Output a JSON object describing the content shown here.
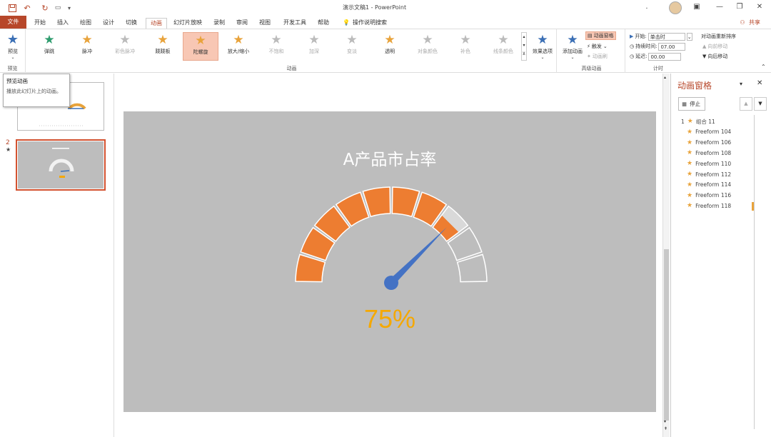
{
  "titlebar": {
    "title": "演示文稿1 - PowerPoint",
    "undo_count": "5"
  },
  "tabs": [
    "文件",
    "开始",
    "插入",
    "绘图",
    "设计",
    "切换",
    "动画",
    "幻灯片放映",
    "录制",
    "审阅",
    "视图",
    "开发工具",
    "帮助"
  ],
  "tell_me": "操作说明搜索",
  "share": "共享",
  "ribbon": {
    "preview": {
      "label": "预览",
      "group": "预览"
    },
    "effects": [
      {
        "label": "弹跳",
        "color": "#2e9c6e"
      },
      {
        "label": "脉冲",
        "color": "#e8a33b"
      },
      {
        "label": "彩色脉冲",
        "color": "#bbbbbb"
      },
      {
        "label": "跷跷板",
        "color": "#e8a33b"
      },
      {
        "label": "陀螺旋",
        "color": "#e8a33b"
      },
      {
        "label": "放大/缩小",
        "color": "#e8a33b"
      },
      {
        "label": "不饱和",
        "color": "#bbbbbb"
      },
      {
        "label": "加深",
        "color": "#bbbbbb"
      },
      {
        "label": "变淡",
        "color": "#bbbbbb"
      },
      {
        "label": "透明",
        "color": "#e8a33b"
      },
      {
        "label": "对象颜色",
        "color": "#bbbbbb"
      },
      {
        "label": "补色",
        "color": "#bbbbbb"
      },
      {
        "label": "线条颜色",
        "color": "#bbbbbb"
      }
    ],
    "effect_options": "效果选项",
    "anim_group": "动画",
    "add_anim": "添加动画",
    "anim_pane_btn": "动画窗格",
    "trigger": "触发",
    "anim_painter": "动画刷",
    "adv_group": "高级动画",
    "start_label": "开始:",
    "start_value": "单击时",
    "duration_label": "持续时间:",
    "duration_value": "07.00",
    "delay_label": "延迟:",
    "delay_value": "00.00",
    "reorder": "对动画重新排序",
    "move_earlier": "向前移动",
    "move_later": "向后移动",
    "timing_group": "计时"
  },
  "tooltip": {
    "title": "预览动画",
    "body": "播放此幻灯片上的动画。"
  },
  "slides": [
    {
      "number": "1"
    },
    {
      "number": "2",
      "star": "★"
    }
  ],
  "slide": {
    "title": "A产品市占率",
    "percent": "75%",
    "gauge_value": 0.75,
    "segments": 10,
    "accent": "#ed7d31",
    "needle": "#4472c4",
    "percent_color": "#f5a800"
  },
  "anim_pane": {
    "title": "动画窗格",
    "stop": "停止",
    "items": [
      {
        "num": "1",
        "label": "组合 11"
      },
      {
        "num": "",
        "label": "Freeform 104"
      },
      {
        "num": "",
        "label": "Freeform 106"
      },
      {
        "num": "",
        "label": "Freeform 108"
      },
      {
        "num": "",
        "label": "Freeform 110"
      },
      {
        "num": "",
        "label": "Freeform 112"
      },
      {
        "num": "",
        "label": "Freeform 114"
      },
      {
        "num": "",
        "label": "Freeform 116"
      },
      {
        "num": "",
        "label": "Freeform 118"
      }
    ]
  }
}
